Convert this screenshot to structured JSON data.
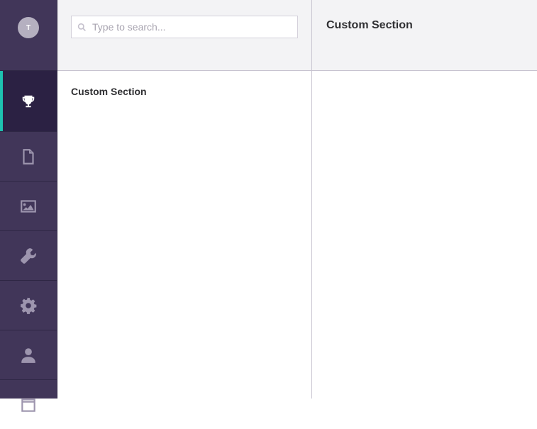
{
  "user": {
    "avatar_initial": "T"
  },
  "sidebar": {
    "items": [
      {
        "icon": "trophy-icon",
        "active": true
      },
      {
        "icon": "document-icon",
        "active": false
      },
      {
        "icon": "image-icon",
        "active": false
      },
      {
        "icon": "wrench-icon",
        "active": false
      },
      {
        "icon": "gear-icon",
        "active": false
      },
      {
        "icon": "user-icon",
        "active": false
      },
      {
        "icon": "calendar-icon",
        "active": false
      }
    ]
  },
  "tree": {
    "search_placeholder": "Type to search...",
    "section_title": "Custom Section"
  },
  "main": {
    "title": "Custom Section"
  },
  "colors": {
    "sidebar_bg": "#413659",
    "active_bg": "#2b2143",
    "active_indicator": "#1ec2b0"
  }
}
